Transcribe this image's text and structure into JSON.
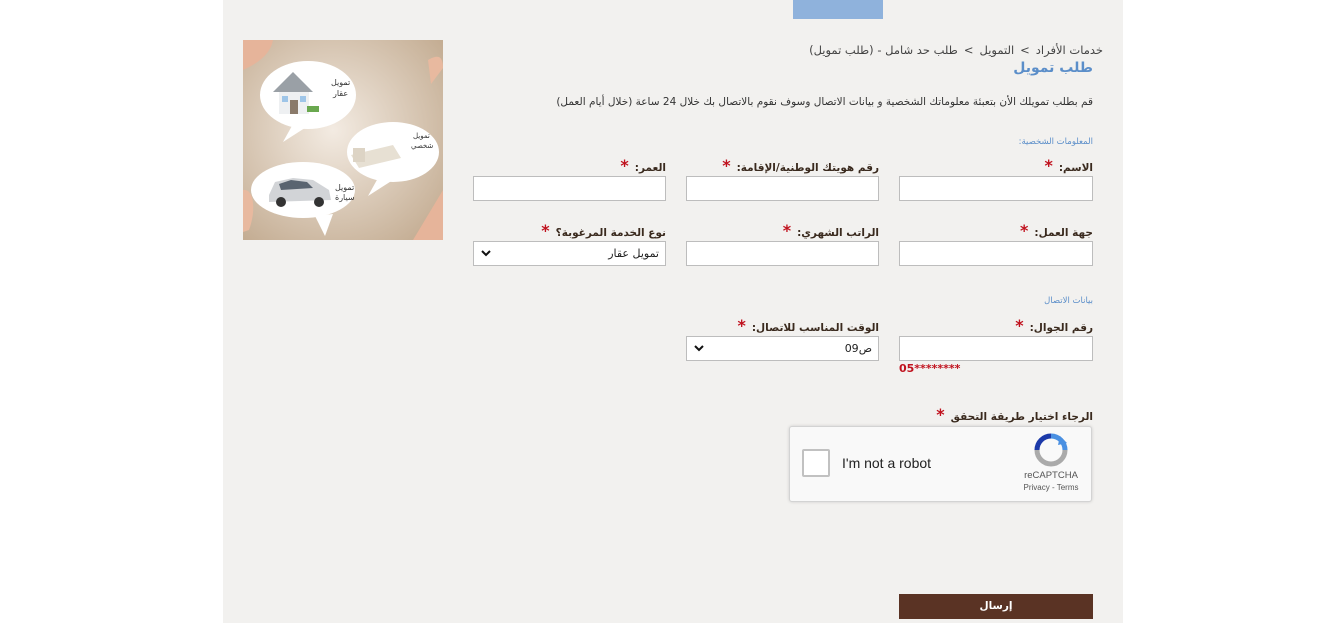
{
  "header": {
    "tab_label": ""
  },
  "breadcrumb": {
    "items": [
      "خدمات الأفراد",
      "التمويل",
      "طلب حد شامل - (طلب تمويل)"
    ],
    "separator": ">"
  },
  "page": {
    "title": "طلب تمويل",
    "intro": "قم بطلب تمويلك الأن بتعبئة معلوماتك الشخصية و بيانات الاتصال وسوف نقوم بالاتصال بك خلال 24 ساعة (خلال أيام العمل)"
  },
  "personal": {
    "section_label": "المعلومات الشخصية:",
    "name_label": "الاسم:",
    "id_label": "رقم هويتك الوطنية/الإقامة:",
    "age_label": "العمر:",
    "employer_label": "جهة العمل:",
    "salary_label": "الراتب الشهري:",
    "service_label": "نوع الخدمة المرغوبة؟",
    "service_value": "تمويل عقار"
  },
  "contact": {
    "section_label": "بيانات الاتصال",
    "mobile_label": "رقم الجوال:",
    "mobile_hint": "05********",
    "time_label": "الوقت المناسب للاتصال:",
    "time_value": "09ص"
  },
  "verification": {
    "label": "الرجاء اختيار طريقة التحقق",
    "captcha_text": "I'm not a robot",
    "captcha_brand": "reCAPTCHA",
    "captcha_links": "Privacy - Terms"
  },
  "required_mark": "*",
  "submit_label": "إرسال",
  "promo": {
    "bubble1": "تمويل عقار",
    "bubble2": "تمويل شخصي",
    "bubble3": "تمويل سيارة"
  },
  "colors": {
    "panel_bg": "#f2f1ef",
    "accent_blue": "#5b8ec9",
    "required_red": "#c0121e",
    "submit_brown": "#5a3324",
    "label_brown": "#3a2a1e"
  }
}
